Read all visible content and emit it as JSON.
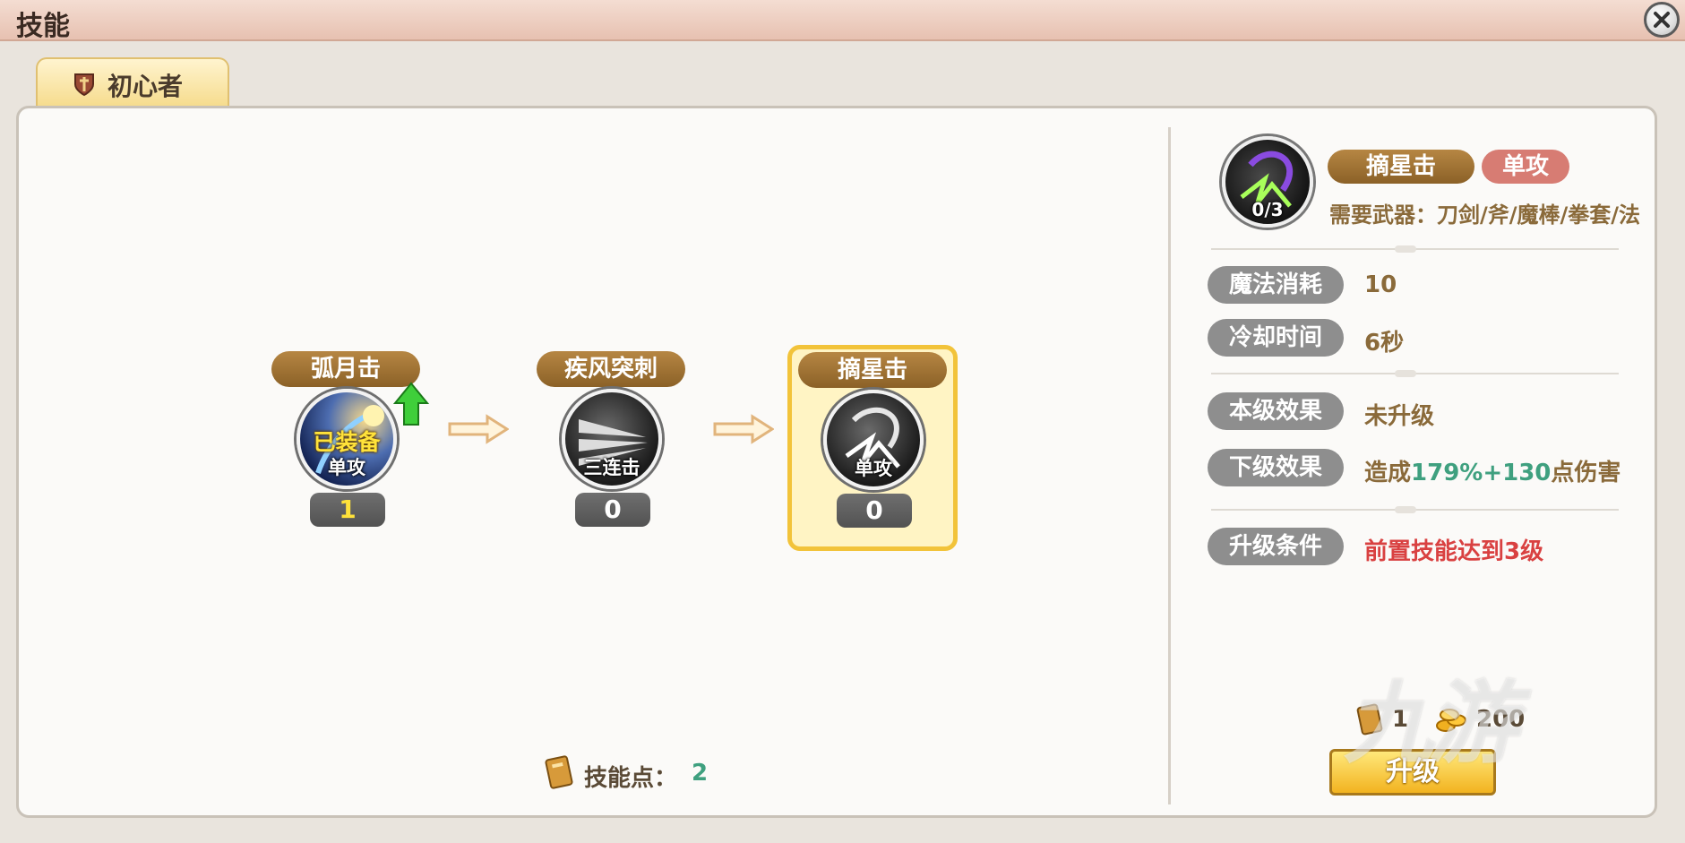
{
  "window": {
    "title": "技能",
    "close_icon": "close-icon"
  },
  "tab": {
    "label": "初心者",
    "icon": "shield-icon"
  },
  "tree": {
    "nodes": [
      {
        "name": "弧月击",
        "tag": "单攻",
        "level": "1",
        "equipped_text": "已装备",
        "upgrade_available": true
      },
      {
        "name": "疾风突刺",
        "tag": "三连击",
        "level": "0"
      },
      {
        "name": "摘星击",
        "tag": "单攻",
        "level": "0",
        "selected": true
      }
    ],
    "skill_points_label": "技能点：",
    "skill_points_value": "2"
  },
  "detail": {
    "name": "摘星击",
    "type": "单攻",
    "level": "0/3",
    "weapon_req": "需要武器：刀剑/斧/魔棒/拳套/法",
    "rows": [
      {
        "label": "魔法消耗",
        "value": "10"
      },
      {
        "label": "冷却时间",
        "value": "6秒"
      },
      {
        "label": "本级效果",
        "value": "未升级"
      },
      {
        "label": "下级效果",
        "value_prefix": "造成",
        "value_highlight": "179%+130",
        "value_suffix": "点伤害"
      },
      {
        "label": "升级条件",
        "value": "前置技能达到3级"
      }
    ],
    "cost": {
      "book": "1",
      "gold": "200"
    },
    "upgrade_label": "升级"
  },
  "watermark": "九游",
  "colors": {
    "accent_gold": "#f2c33a",
    "highlight_green": "#3fa07f",
    "warning_red": "#d94141",
    "plate_brown": "#8b6127"
  }
}
